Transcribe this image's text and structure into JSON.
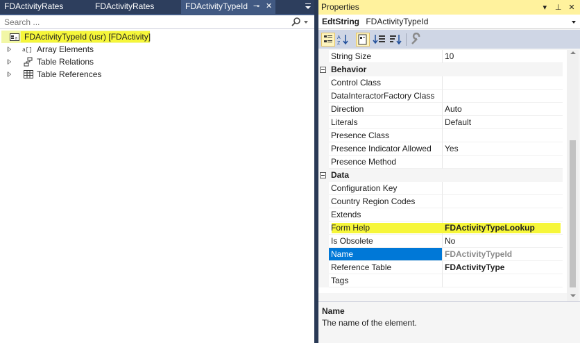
{
  "tabs": [
    {
      "label": "FDActivityRates",
      "active": false
    },
    {
      "label": "FDActivityRates",
      "active": false
    },
    {
      "label": "FDActivityTypeId",
      "active": true
    }
  ],
  "search": {
    "placeholder": "Search ..."
  },
  "tree": {
    "root": {
      "label": "FDActivityTypeId (usr) [FDActivity]",
      "icon": "edt-string-icon"
    },
    "children": [
      {
        "label": "Array Elements",
        "icon": "array-icon"
      },
      {
        "label": "Table Relations",
        "icon": "relation-icon"
      },
      {
        "label": "Table References",
        "icon": "table-icon"
      }
    ]
  },
  "properties": {
    "title": "Properties",
    "object_type": "EdtString",
    "object_name": "FDActivityTypeId",
    "rows": [
      {
        "kind": "prop",
        "name": "String Size",
        "value": "10"
      },
      {
        "kind": "cat",
        "name": "Behavior"
      },
      {
        "kind": "prop",
        "name": "Control Class",
        "value": ""
      },
      {
        "kind": "prop",
        "name": "DataInteractorFactory Class",
        "value": ""
      },
      {
        "kind": "prop",
        "name": "Direction",
        "value": "Auto"
      },
      {
        "kind": "prop",
        "name": "Literals",
        "value": "Default"
      },
      {
        "kind": "prop",
        "name": "Presence Class",
        "value": ""
      },
      {
        "kind": "prop",
        "name": "Presence Indicator Allowed",
        "value": "Yes"
      },
      {
        "kind": "prop",
        "name": "Presence Method",
        "value": ""
      },
      {
        "kind": "cat",
        "name": "Data"
      },
      {
        "kind": "prop",
        "name": "Configuration Key",
        "value": ""
      },
      {
        "kind": "prop",
        "name": "Country Region Codes",
        "value": ""
      },
      {
        "kind": "prop",
        "name": "Extends",
        "value": ""
      },
      {
        "kind": "prop",
        "name": "Form Help",
        "value": "FDActivityTypeLookup",
        "bold": true,
        "highlight": true
      },
      {
        "kind": "prop",
        "name": "Is Obsolete",
        "value": "No"
      },
      {
        "kind": "prop",
        "name": "Name",
        "value": "FDActivityTypeId",
        "selected": true,
        "dim": true
      },
      {
        "kind": "prop",
        "name": "Reference Table",
        "value": "FDActivityType",
        "bold": true
      },
      {
        "kind": "prop",
        "name": "Tags",
        "value": ""
      }
    ],
    "description": {
      "title": "Name",
      "text": "The name of the element."
    }
  },
  "colors": {
    "title_bar": "#fff29d",
    "highlight": "#f6f63a",
    "selection": "#0078d7",
    "chrome": "#293955"
  }
}
